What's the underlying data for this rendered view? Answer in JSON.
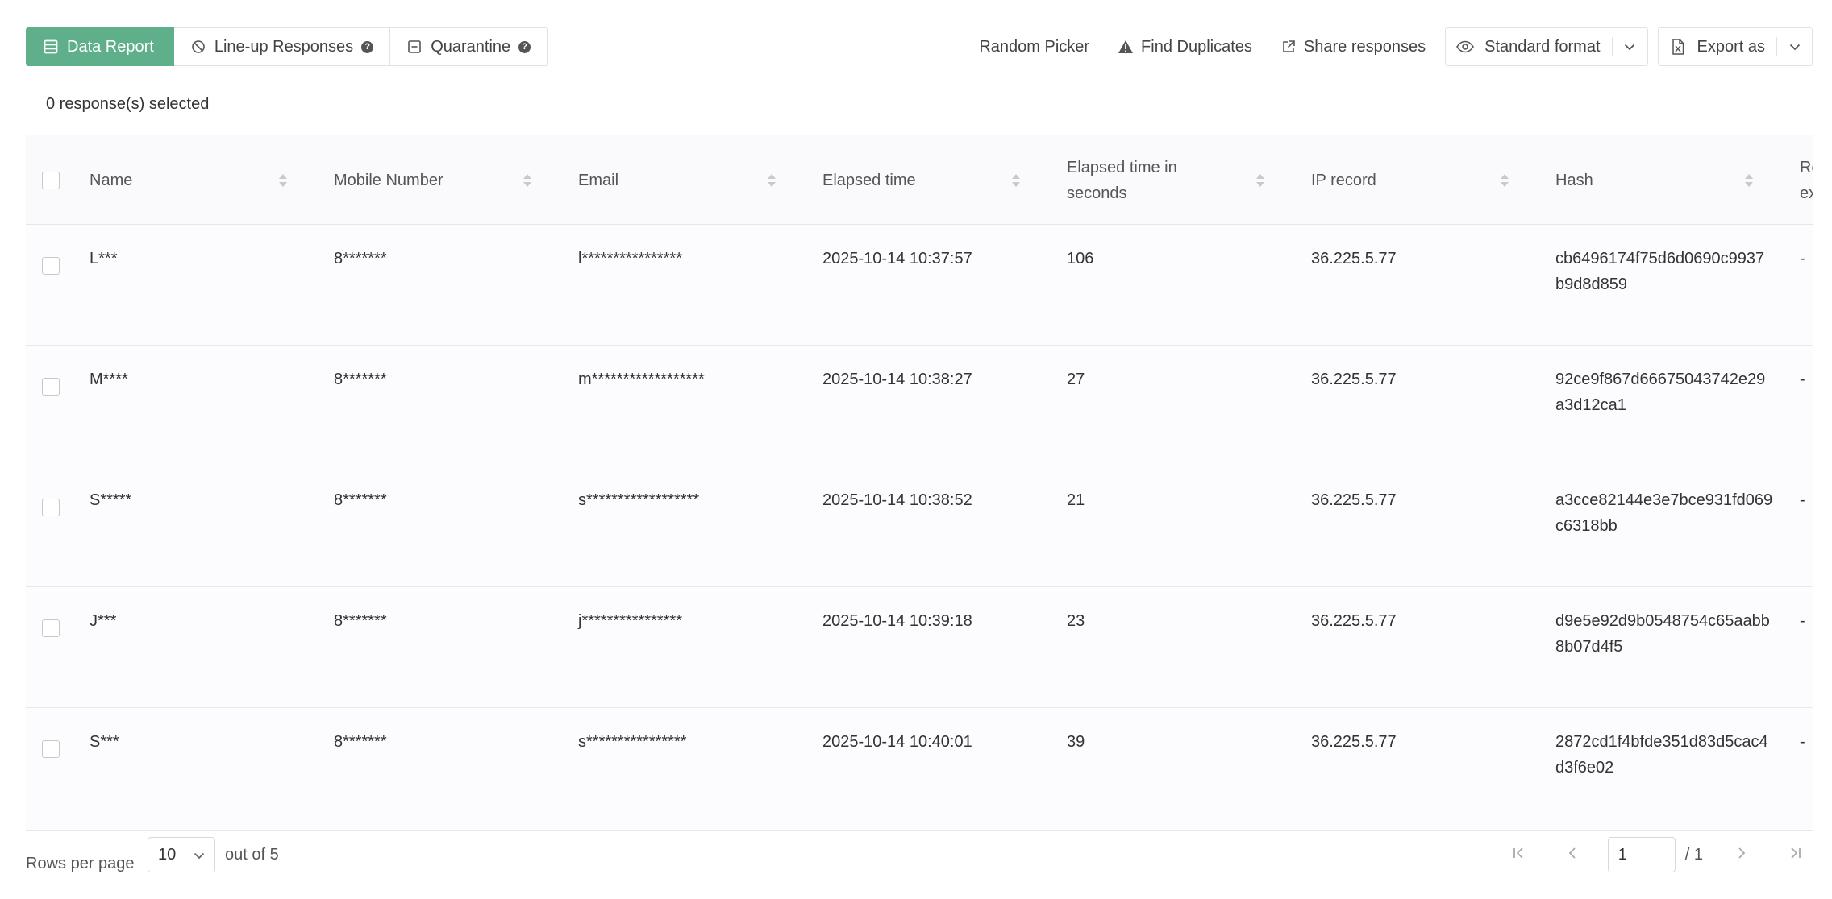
{
  "toolbar": {
    "tabs": [
      {
        "label": "Data Report",
        "icon": "table-icon",
        "active": true
      },
      {
        "label": "Line-up Responses",
        "icon": "ban-icon"
      },
      {
        "label": "Quarantine",
        "icon": "minus-square-icon"
      }
    ],
    "actions": {
      "random_picker": "Random Picker",
      "find_duplicates": "Find Duplicates",
      "share_responses": "Share responses",
      "format_value": "Standard format",
      "export_label": "Export as"
    }
  },
  "selection": {
    "count_text": "0 response(s) selected"
  },
  "table": {
    "columns": [
      "Name",
      "Mobile Number",
      "Email",
      "Elapsed time",
      "Elapsed time in seconds",
      "IP record",
      "Hash",
      "Re ex"
    ],
    "rows": [
      {
        "name": "L***",
        "mobile": "8*******",
        "email": "l****************",
        "elapsed": "2025-10-14 10:37:57",
        "seconds": "106",
        "ip": "36.225.5.77",
        "hash": "cb6496174f75d6d0690c9937b9d8d859",
        "extra": "-"
      },
      {
        "name": "M****",
        "mobile": "8*******",
        "email": "m******************",
        "elapsed": "2025-10-14 10:38:27",
        "seconds": "27",
        "ip": "36.225.5.77",
        "hash": "92ce9f867d66675043742e29a3d12ca1",
        "extra": "-"
      },
      {
        "name": "S*****",
        "mobile": "8*******",
        "email": "s******************",
        "elapsed": "2025-10-14 10:38:52",
        "seconds": "21",
        "ip": "36.225.5.77",
        "hash": "a3cce82144e3e7bce931fd069c6318bb",
        "extra": "-"
      },
      {
        "name": "J***",
        "mobile": "8*******",
        "email": "j****************",
        "elapsed": "2025-10-14 10:39:18",
        "seconds": "23",
        "ip": "36.225.5.77",
        "hash": "d9e5e92d9b0548754c65aabb8b07d4f5",
        "extra": "-"
      },
      {
        "name": "S***",
        "mobile": "8*******",
        "email": "s****************",
        "elapsed": "2025-10-14 10:40:01",
        "seconds": "39",
        "ip": "36.225.5.77",
        "hash": "2872cd1f4bfde351d83d5cac4d3f6e02",
        "extra": "-"
      }
    ]
  },
  "footer": {
    "rows_per_page_label": "Rows per page",
    "rows_per_page_value": "10",
    "total_text": "out of 5",
    "current_page": "1",
    "total_pages_text": "/ 1"
  },
  "colors": {
    "accent": "#5fb08a",
    "header_bg": "#faf9fb",
    "row_bg": "#fcfbfd",
    "border": "#e6e6e6"
  }
}
